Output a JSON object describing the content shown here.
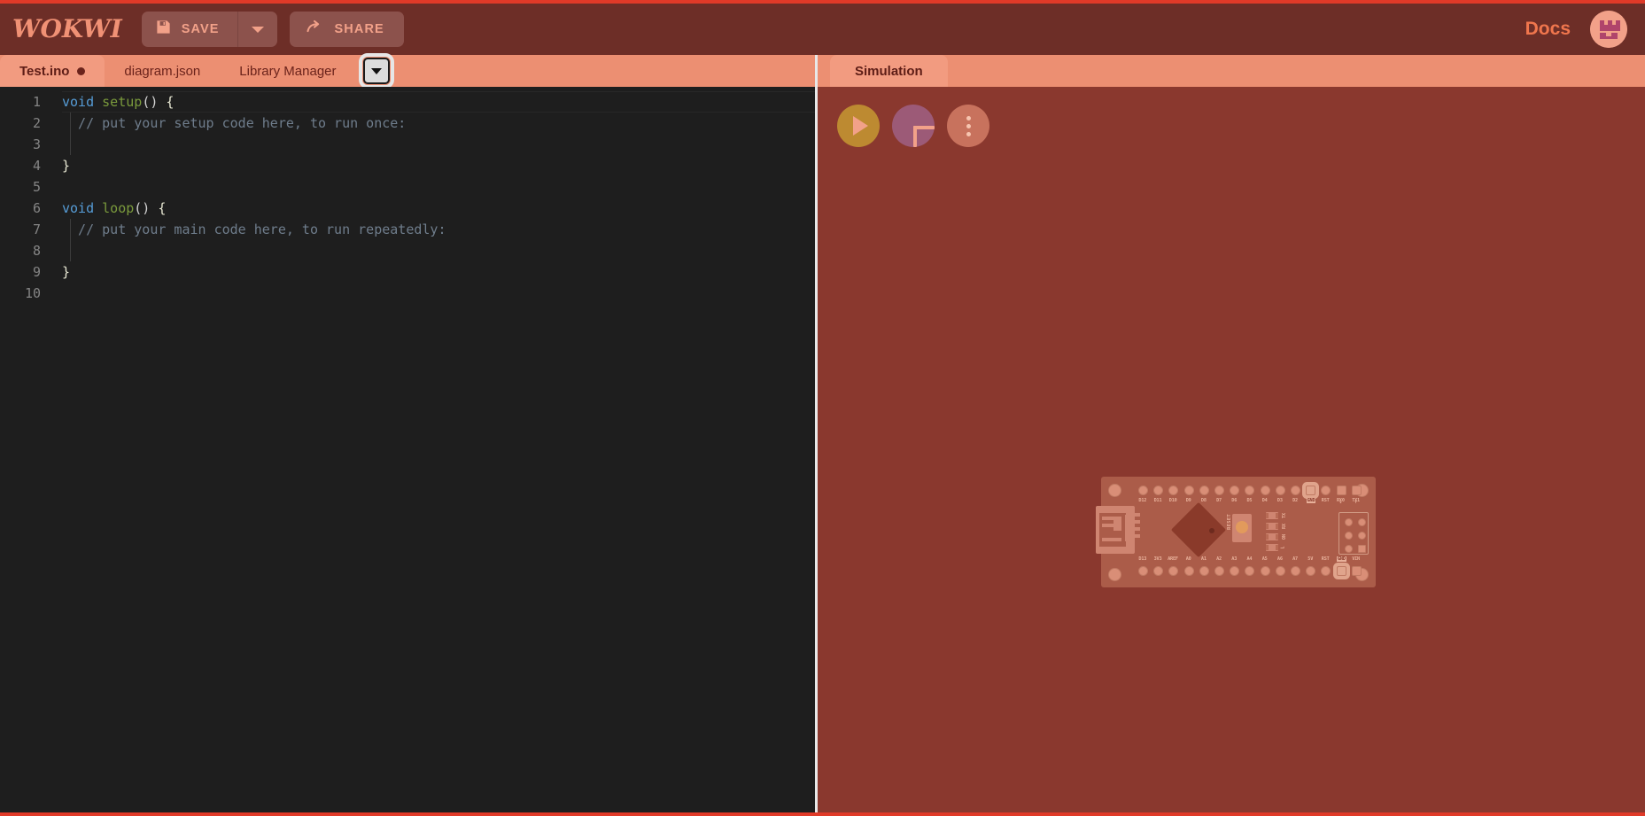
{
  "header": {
    "logo": "WOKWI",
    "save_label": "SAVE",
    "share_label": "SHARE",
    "docs_label": "Docs",
    "save_icon": "floppy-disk-icon",
    "share_icon": "share-arrow-icon",
    "caret_icon": "chevron-down-icon",
    "avatar_icon": "user-avatar-icon",
    "bg_color": "#6d2e27",
    "accent_color": "#f2a189",
    "docs_color": "#f0764d"
  },
  "editor": {
    "tabs": [
      {
        "label": "Test.ino",
        "active": true,
        "dirty": true
      },
      {
        "label": "diagram.json",
        "active": false,
        "dirty": false
      },
      {
        "label": "Library Manager",
        "active": false,
        "dirty": false
      }
    ],
    "tab_menu_icon": "chevron-down-icon",
    "line_numbers": [
      "1",
      "2",
      "3",
      "4",
      "5",
      "6",
      "7",
      "8",
      "9",
      "10"
    ],
    "lines": [
      {
        "n": 1,
        "tokens": [
          {
            "t": "void ",
            "c": "kw"
          },
          {
            "t": "setup",
            "c": "fn"
          },
          {
            "t": "()",
            "c": "pun"
          },
          {
            "t": " {",
            "c": "brace"
          }
        ]
      },
      {
        "n": 2,
        "indent": true,
        "tokens": [
          {
            "t": "  // put your setup code here, to run once:",
            "c": "cmt"
          }
        ]
      },
      {
        "n": 3,
        "indent": true,
        "tokens": []
      },
      {
        "n": 4,
        "tokens": [
          {
            "t": "}",
            "c": "brace"
          }
        ]
      },
      {
        "n": 5,
        "tokens": []
      },
      {
        "n": 6,
        "tokens": [
          {
            "t": "void ",
            "c": "kw"
          },
          {
            "t": "loop",
            "c": "fn"
          },
          {
            "t": "()",
            "c": "pun"
          },
          {
            "t": " {",
            "c": "brace"
          }
        ]
      },
      {
        "n": 7,
        "indent": true,
        "tokens": [
          {
            "t": "  // put your main code here, to run repeatedly:",
            "c": "cmt"
          }
        ]
      },
      {
        "n": 8,
        "indent": true,
        "tokens": []
      },
      {
        "n": 9,
        "tokens": [
          {
            "t": "}",
            "c": "brace"
          }
        ]
      },
      {
        "n": 10,
        "tokens": []
      }
    ],
    "bg_color": "#1e1e1e",
    "gutter_color": "#858585"
  },
  "simulation": {
    "tab_label": "Simulation",
    "controls": [
      {
        "name": "play-button",
        "icon": "play-icon",
        "color": "#bd8a31"
      },
      {
        "name": "add-part-button",
        "icon": "plus-icon",
        "color": "#9c5a77"
      },
      {
        "name": "more-menu-button",
        "icon": "dots-vertical-icon",
        "color": "#c8725d"
      }
    ],
    "bg_color": "#8a382e"
  },
  "board": {
    "name": "Arduino Nano",
    "top_pins": [
      "D12",
      "D11",
      "D10",
      "D9",
      "D8",
      "D7",
      "D6",
      "D5",
      "D4",
      "D3",
      "D2",
      "GND",
      "RST",
      "RX0",
      "TX1"
    ],
    "bottom_pins": [
      "D13",
      "3V3",
      "AREF",
      "A0",
      "A1",
      "A2",
      "A3",
      "A4",
      "A5",
      "A6",
      "A7",
      "5V",
      "RST",
      "GND",
      "VIN"
    ],
    "reset_label": "RESET",
    "led_labels": [
      "TX",
      "RX",
      "ON",
      "L"
    ],
    "rx_arrow": "↓",
    "tx_arrow": "↑",
    "pcb_color": "#ab5c49",
    "pad_color": "#d98e77",
    "silk_color": "#e8b09a"
  }
}
